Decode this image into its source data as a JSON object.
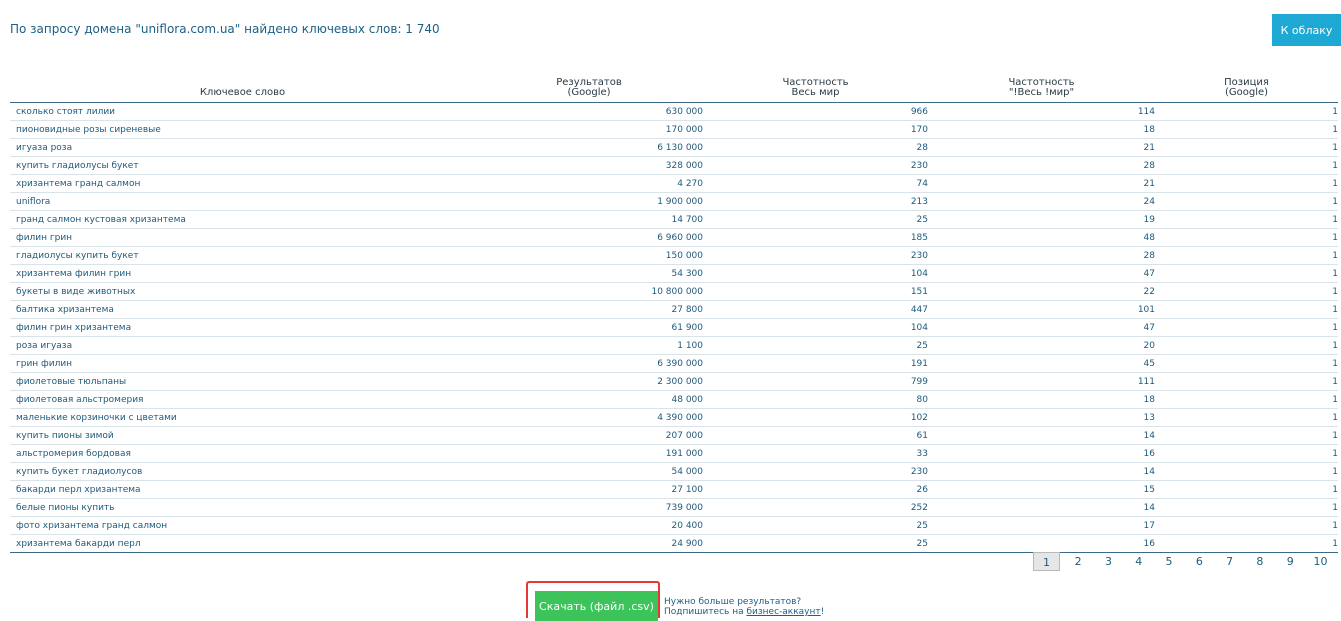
{
  "summary": "По запросу домена \"uniflora.com.ua\" найдено ключевых слов: 1 740",
  "cloud_button": "К облаку",
  "columns": {
    "keyword": "Ключевое слово",
    "results_1": "Результатов",
    "results_2": "(Google)",
    "freq_1": "Частотность",
    "freq_2": "Весь мир",
    "exact_1": "Частотность",
    "exact_2": "\"!Весь !мир\"",
    "pos_1": "Позиция",
    "pos_2": "(Google)"
  },
  "rows": [
    {
      "keyword": "сколько стоят лилии",
      "results": "630 000",
      "freq": "966",
      "exact": "114",
      "pos": "1"
    },
    {
      "keyword": "пионовидные розы сиреневые",
      "results": "170 000",
      "freq": "170",
      "exact": "18",
      "pos": "1"
    },
    {
      "keyword": "игуаза роза",
      "results": "6 130 000",
      "freq": "28",
      "exact": "21",
      "pos": "1"
    },
    {
      "keyword": "купить гладиолусы букет",
      "results": "328 000",
      "freq": "230",
      "exact": "28",
      "pos": "1"
    },
    {
      "keyword": "хризантема гранд салмон",
      "results": "4 270",
      "freq": "74",
      "exact": "21",
      "pos": "1"
    },
    {
      "keyword": "uniflora",
      "results": "1 900 000",
      "freq": "213",
      "exact": "24",
      "pos": "1"
    },
    {
      "keyword": "гранд салмон кустовая хризантема",
      "results": "14 700",
      "freq": "25",
      "exact": "19",
      "pos": "1"
    },
    {
      "keyword": "филин грин",
      "results": "6 960 000",
      "freq": "185",
      "exact": "48",
      "pos": "1"
    },
    {
      "keyword": "гладиолусы купить букет",
      "results": "150 000",
      "freq": "230",
      "exact": "28",
      "pos": "1"
    },
    {
      "keyword": "хризантема филин грин",
      "results": "54 300",
      "freq": "104",
      "exact": "47",
      "pos": "1"
    },
    {
      "keyword": "букеты в виде животных",
      "results": "10 800 000",
      "freq": "151",
      "exact": "22",
      "pos": "1"
    },
    {
      "keyword": "балтика хризантема",
      "results": "27 800",
      "freq": "447",
      "exact": "101",
      "pos": "1"
    },
    {
      "keyword": "филин грин хризантема",
      "results": "61 900",
      "freq": "104",
      "exact": "47",
      "pos": "1"
    },
    {
      "keyword": "роза игуаза",
      "results": "1 100",
      "freq": "25",
      "exact": "20",
      "pos": "1"
    },
    {
      "keyword": "грин филин",
      "results": "6 390 000",
      "freq": "191",
      "exact": "45",
      "pos": "1"
    },
    {
      "keyword": "фиолетовые тюльпаны",
      "results": "2 300 000",
      "freq": "799",
      "exact": "111",
      "pos": "1"
    },
    {
      "keyword": "фиолетовая альстромерия",
      "results": "48 000",
      "freq": "80",
      "exact": "18",
      "pos": "1"
    },
    {
      "keyword": "маленькие корзиночки с цветами",
      "results": "4 390 000",
      "freq": "102",
      "exact": "13",
      "pos": "1"
    },
    {
      "keyword": "купить пионы зимой",
      "results": "207 000",
      "freq": "61",
      "exact": "14",
      "pos": "1"
    },
    {
      "keyword": "альстромерия бордовая",
      "results": "191 000",
      "freq": "33",
      "exact": "16",
      "pos": "1"
    },
    {
      "keyword": "купить букет гладиолусов",
      "results": "54 000",
      "freq": "230",
      "exact": "14",
      "pos": "1"
    },
    {
      "keyword": "бакарди перл хризантема",
      "results": "27 100",
      "freq": "26",
      "exact": "15",
      "pos": "1"
    },
    {
      "keyword": "белые пионы купить",
      "results": "739 000",
      "freq": "252",
      "exact": "14",
      "pos": "1"
    },
    {
      "keyword": "фото хризантема гранд салмон",
      "results": "20 400",
      "freq": "25",
      "exact": "17",
      "pos": "1"
    },
    {
      "keyword": "хризантема бакарди перл",
      "results": "24 900",
      "freq": "25",
      "exact": "16",
      "pos": "1"
    }
  ],
  "pagination": {
    "current": "1",
    "pages": [
      "1",
      "2",
      "3",
      "4",
      "5",
      "6",
      "7",
      "8",
      "9",
      "10"
    ]
  },
  "download_button": "Скачать (файл .csv)",
  "promo": {
    "line1": "Нужно больше результатов?",
    "line2_prefix": "Подпишитесь на ",
    "line2_link": "бизнес-аккаунт",
    "line2_suffix": "!"
  },
  "colors": {
    "accent_blue": "#1ea9d4",
    "download_green": "#3cc45a",
    "highlight_red": "#e53935"
  }
}
